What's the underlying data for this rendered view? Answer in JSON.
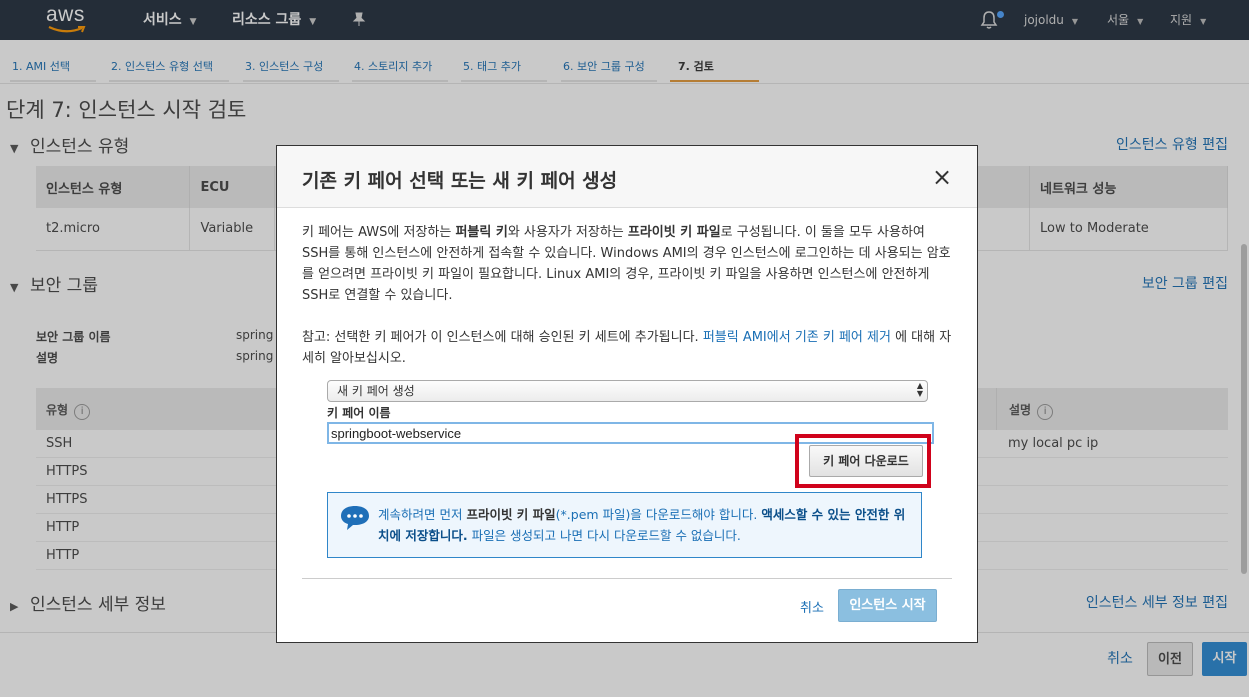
{
  "nav": {
    "logo": "aws",
    "services": "서비스",
    "resource_groups": "리소스 그룹",
    "pin_icon": "pin-icon",
    "bell_icon": "bell-icon",
    "user": "jojoldu",
    "region": "서울",
    "support": "지원"
  },
  "wizard": {
    "tabs": [
      {
        "label": "1. AMI 선택"
      },
      {
        "label": "2. 인스턴스 유형 선택"
      },
      {
        "label": "3. 인스턴스 구성"
      },
      {
        "label": "4. 스토리지 추가"
      },
      {
        "label": "5. 태그 추가"
      },
      {
        "label": "6. 보안 그룹 구성"
      },
      {
        "label": "7. 검토"
      }
    ],
    "active_tab": "7. 검토",
    "active_color": "#e49a3a"
  },
  "page": {
    "title": "단계 7: 인스턴스 시작 검토",
    "instance_type": {
      "title": "인스턴스 유형",
      "edit": "인스턴스 유형 편집",
      "headers": [
        "인스턴스 유형",
        "ECU",
        "네트워크 성능"
      ],
      "row": [
        "t2.micro",
        "Variable",
        "Low to Moderate"
      ]
    },
    "security_group": {
      "title": "보안 그룹",
      "edit": "보안 그룹 편집",
      "name_label": "보안 그룹 이름",
      "name_value": "spring",
      "desc_label": "설명",
      "desc_value": "spring",
      "rules_headers": {
        "type": "유형",
        "desc": "설명"
      },
      "rules": [
        {
          "type": "SSH",
          "desc": "my local pc ip"
        },
        {
          "type": "HTTPS",
          "desc": ""
        },
        {
          "type": "HTTPS",
          "desc": ""
        },
        {
          "type": "HTTP",
          "desc": ""
        },
        {
          "type": "HTTP",
          "desc": ""
        }
      ]
    },
    "instance_details": {
      "title": "인스턴스 세부 정보",
      "edit": "인스턴스 세부 정보 편집"
    },
    "footer": {
      "cancel": "취소",
      "prev": "이전",
      "launch": "시작"
    }
  },
  "modal": {
    "title": "기존 키 페어 선택 또는 새 키 페어 생성",
    "close": "×",
    "intro_1": "키 페어는 AWS에 저장하는 ",
    "intro_public": "퍼블릭 키",
    "intro_2": "와 사용자가 저장하는 ",
    "intro_private": "프라이빗 키 파일",
    "intro_3": "로 구성됩니다. 이 둘을 모두 사용하여 SSH를 통해 인스턴스에 안전하게 접속할 수 있습니다. Windows AMI의 경우 인스턴스에 로그인하는 데 사용되는 암호를 얻으려면 프라이빗 키 파일이 필요합니다. Linux AMI의 경우, 프라이빗 키 파일을 사용하면 인스턴스에 안전하게 SSH로 연결할 수 있습니다.",
    "note_1": "참고: 선택한 키 페어가 이 인스턴스에 대해 승인된 키 세트에 추가됩니다. ",
    "note_link": "퍼블릭 AMI에서 기존 키 페어 제거",
    "note_2": " 에 대해 자세히 알아보십시오.",
    "select_value": "새 키 페어 생성",
    "key_name_label": "키 페어 이름",
    "key_name_value": "springboot-webservice",
    "download_button": "키 페어 다운로드",
    "alert_1": "계속하려면 먼저 ",
    "alert_bold_1": "프라이빗 키 파일",
    "alert_2": "(*.pem 파일)을 다운로드해야 합니다. ",
    "alert_bold_2": "액세스할 수 있는 안전한 위치에 저장합니다.",
    "alert_3": " 파일은 생성되고 나면 다시 다운로드할 수 없습니다.",
    "chat_icon": "chat-bubble-icon",
    "cancel": "취소",
    "launch": "인스턴스 시작",
    "highlight_color": "#d0021b"
  }
}
